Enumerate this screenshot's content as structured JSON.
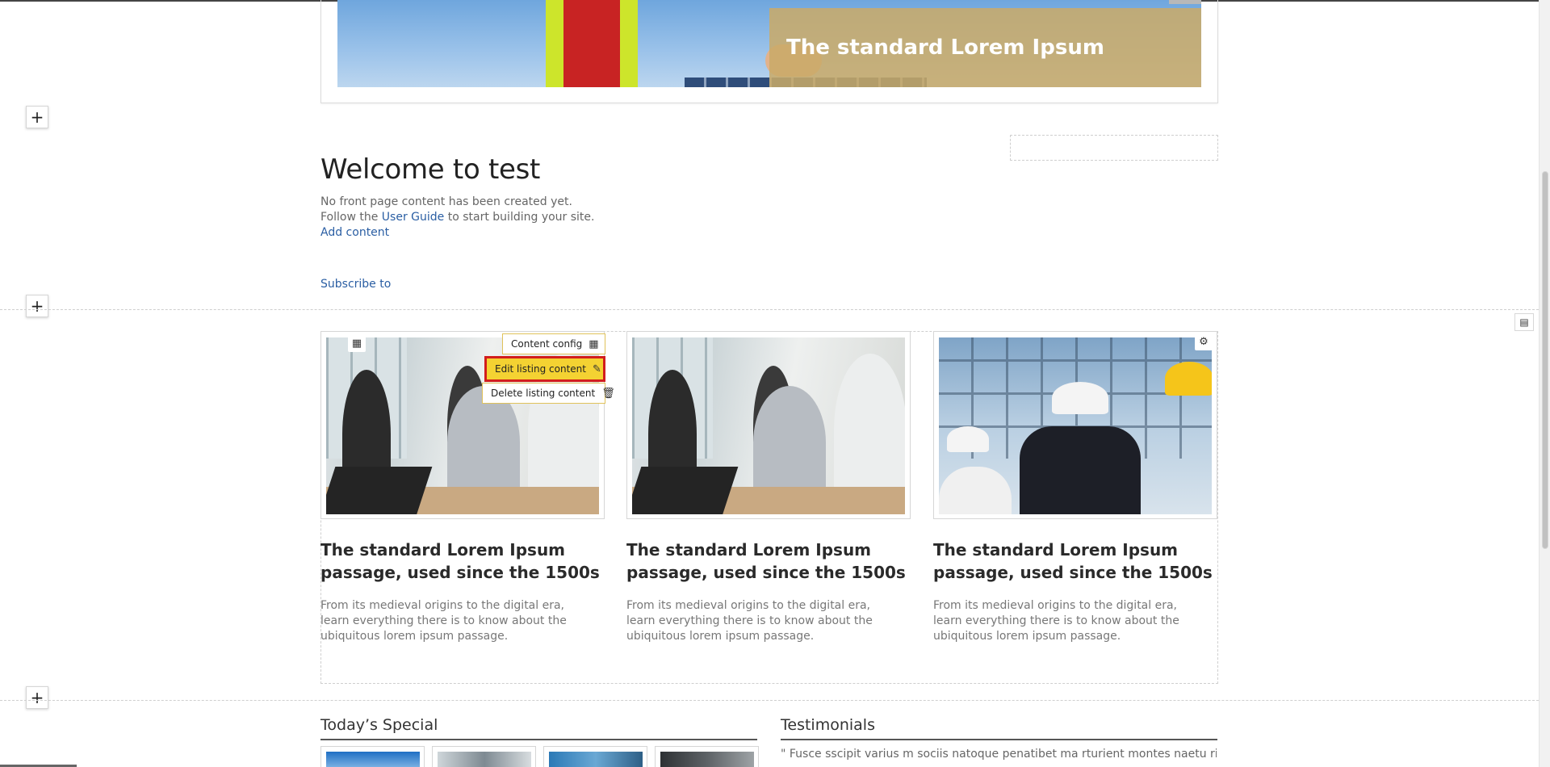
{
  "hero": {
    "title": "The standard Lorem Ipsum"
  },
  "welcome": {
    "title": "Welcome to test",
    "line1": "No front page content has been created yet.",
    "line2_prefix": "Follow the",
    "user_guide_link": "User Guide",
    "line2_suffix": "to start building your site.",
    "add_content_link": "Add content"
  },
  "subscribe_link": "Subscribe to",
  "block_controls": {
    "add_symbol": "+"
  },
  "context_menu": {
    "items": [
      {
        "label": "Content config",
        "icon": "qr-config-icon"
      },
      {
        "label": "Edit listing content",
        "icon": "edit-icon",
        "active": true
      },
      {
        "label": "Delete listing content",
        "icon": "trash-icon"
      }
    ]
  },
  "cards": [
    {
      "title": "The standard Lorem Ipsum passage, used since the 1500s",
      "description": "From its medieval origins to the digital era, learn everything there is to know about the ubiquitous lorem ipsum passage.",
      "image": "office-meeting"
    },
    {
      "title": "The standard Lorem Ipsum passage, used since the 1500s",
      "description": "From its medieval origins to the digital era, learn everything there is to know about the ubiquitous lorem ipsum passage.",
      "image": "office-meeting"
    },
    {
      "title": "The standard Lorem Ipsum passage, used since the 1500s",
      "description": "From its medieval origins to the digital era, learn everything there is to know about the ubiquitous lorem ipsum passage.",
      "image": "construction-workers"
    }
  ],
  "todays_special": {
    "heading": "Today’s Special"
  },
  "testimonials": {
    "heading": "Testimonials",
    "text": "\" Fusce sscipit varius m sociis natoque penatibet ma rturient montes naetu ridiculu"
  },
  "colors": {
    "link": "#2a5ea3",
    "hero_overlay": "#c9aa68",
    "menu_active": "#f4d232",
    "menu_active_border": "#d21d1d"
  }
}
